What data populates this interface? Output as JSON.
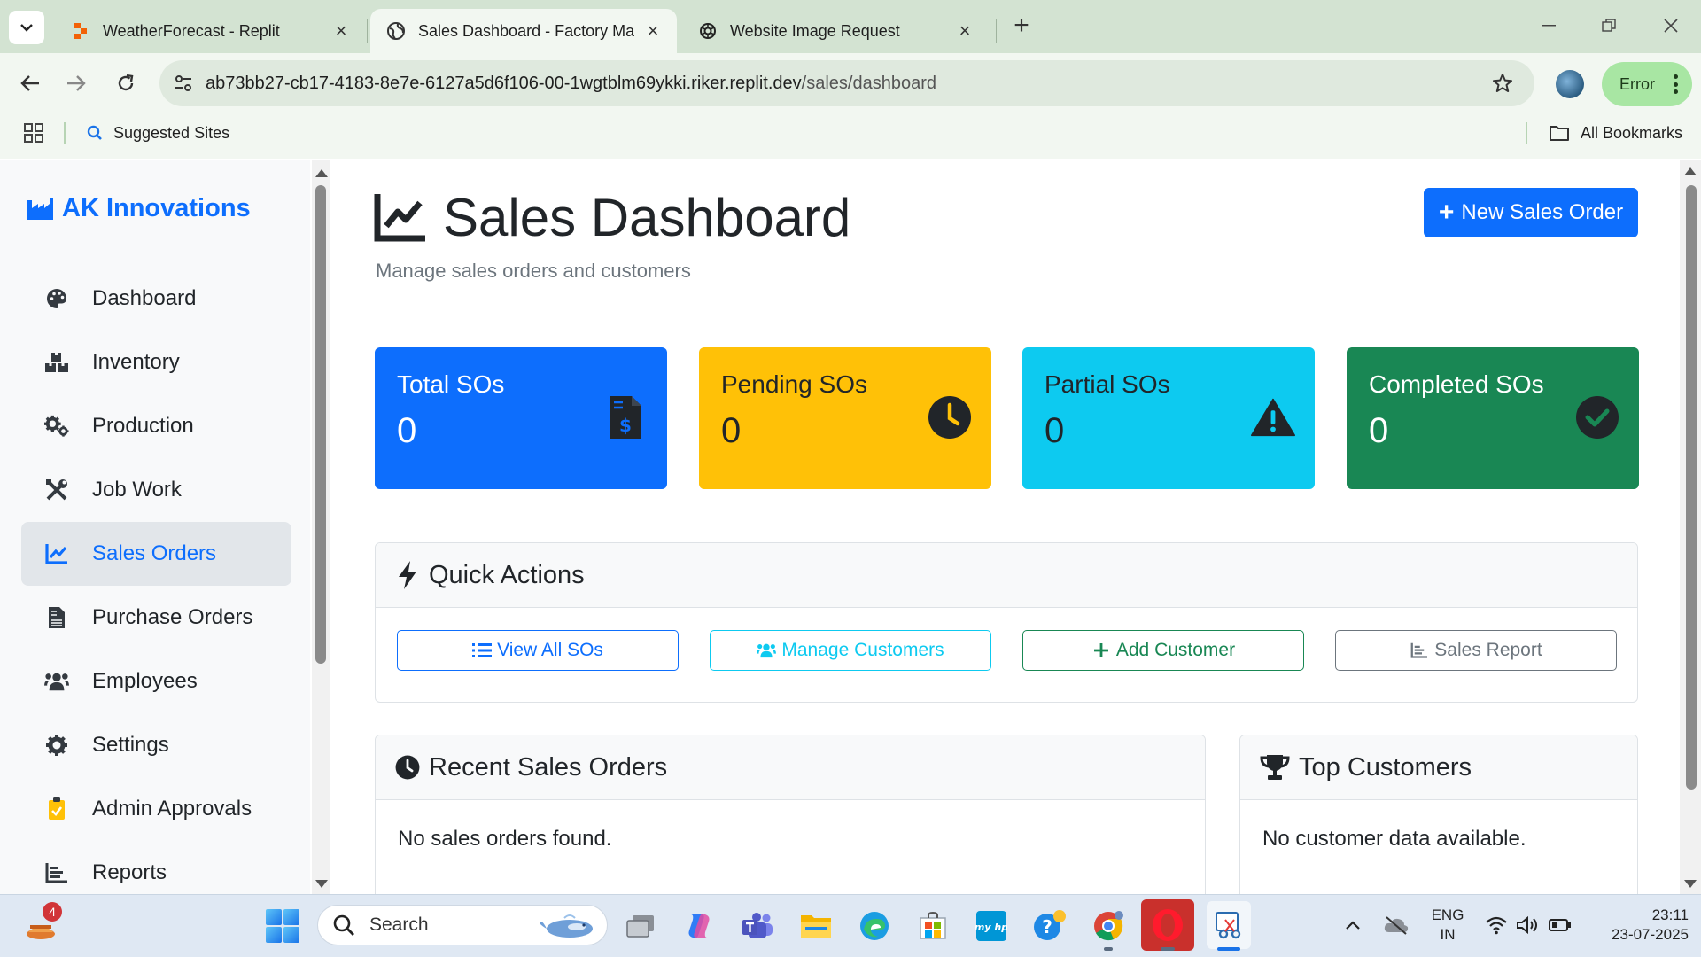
{
  "browser": {
    "tabs": [
      {
        "title": "WeatherForecast - Replit",
        "favicon": "replit-icon"
      },
      {
        "title": "Sales Dashboard - Factory Mana",
        "favicon": "globe-icon"
      },
      {
        "title": "Website Image Request",
        "favicon": "chatgpt-icon"
      }
    ],
    "url_host": "ab73bb27-cb17-4183-8e7e-6127a5d6f106-00-1wgtblm69ykki.riker.replit.dev",
    "url_path": "/sales/dashboard",
    "profile_status": "Error",
    "bookmarks": {
      "suggested": "Suggested Sites",
      "all": "All Bookmarks"
    }
  },
  "sidebar": {
    "brand": "AK Innovations",
    "items": [
      {
        "label": "Dashboard",
        "icon": "palette-icon"
      },
      {
        "label": "Inventory",
        "icon": "boxes-icon"
      },
      {
        "label": "Production",
        "icon": "cogs-icon"
      },
      {
        "label": "Job Work",
        "icon": "tools-icon"
      },
      {
        "label": "Sales Orders",
        "icon": "chart-line-icon",
        "active": true
      },
      {
        "label": "Purchase Orders",
        "icon": "file-invoice-icon"
      },
      {
        "label": "Employees",
        "icon": "users-icon"
      },
      {
        "label": "Settings",
        "icon": "gear-icon"
      },
      {
        "label": "Admin Approvals",
        "icon": "clipboard-check-icon"
      },
      {
        "label": "Reports",
        "icon": "chart-bar-icon"
      }
    ]
  },
  "main": {
    "title": "Sales Dashboard",
    "subtitle": "Manage sales orders and customers",
    "new_order_button": "New Sales Order",
    "stats": [
      {
        "label": "Total SOs",
        "value": "0",
        "color": "#0d6efd",
        "text_color": "#ffffff",
        "icon": "file-invoice-dollar-icon"
      },
      {
        "label": "Pending SOs",
        "value": "0",
        "color": "#ffc107",
        "text_color": "#212529",
        "icon": "clock-icon"
      },
      {
        "label": "Partial SOs",
        "value": "0",
        "color": "#0dcaf0",
        "text_color": "#212529",
        "icon": "warning-icon"
      },
      {
        "label": "Completed SOs",
        "value": "0",
        "color": "#198754",
        "text_color": "#ffffff",
        "icon": "check-circle-icon"
      }
    ],
    "quick_actions": {
      "title": "Quick Actions",
      "buttons": [
        {
          "label": "View All SOs",
          "color": "#0d6efd"
        },
        {
          "label": "Manage Customers",
          "color": "#0dcaf0"
        },
        {
          "label": "Add Customer",
          "color": "#198754"
        },
        {
          "label": "Sales Report",
          "color": "#6c757d"
        }
      ]
    },
    "recent_orders": {
      "title": "Recent Sales Orders",
      "empty_text": "No sales orders found."
    },
    "top_customers": {
      "title": "Top Customers",
      "empty_text": "No customer data available."
    }
  },
  "taskbar": {
    "search_placeholder": "Search",
    "weather_badge": "4",
    "language": "ENG",
    "region": "IN",
    "time": "23:11",
    "date": "23-07-2025"
  }
}
